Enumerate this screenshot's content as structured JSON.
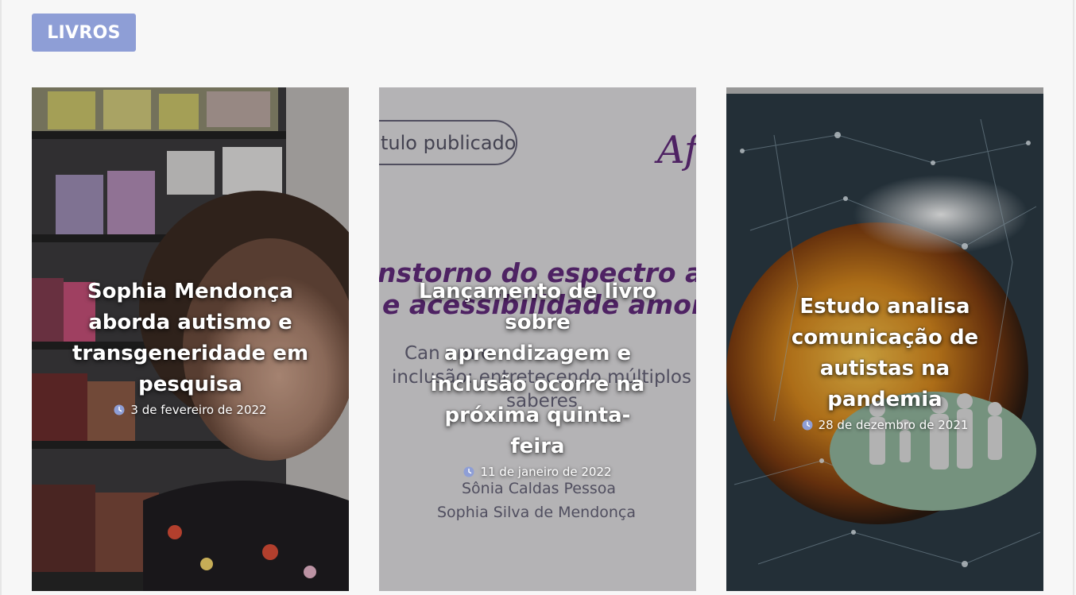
{
  "section": {
    "label": "LIVROS"
  },
  "cards": [
    {
      "title": "Sophia Mendonça aborda autismo e transgeneridade em pesquisa",
      "date": "3 de fevereiro de 2022"
    },
    {
      "title": "Lançamento de livro sobre aprendizagem e inclusão ocorre na próxima quinta-feira",
      "date": "11 de janeiro de 2022",
      "image_text": {
        "tag": "tulo publicado",
        "logo": "Af",
        "headline_1": "nstorno do espectro auti",
        "headline_2": "e acessibilidade amoroso",
        "subtitle_1": "Can                              em e",
        "subtitle_2": "inclusão: entretecendo múltiplos",
        "subtitle_3": "saberes",
        "author_1": "Sônia Caldas Pessoa",
        "author_2": "Sophia Silva  de Mendonça"
      }
    },
    {
      "title": "Estudo analisa comunicação de autistas na pandemia",
      "date": "28 de dezembro de 2021"
    }
  ],
  "colors": {
    "accent": "#8e9ed6",
    "clock": "#8e9ed6"
  }
}
